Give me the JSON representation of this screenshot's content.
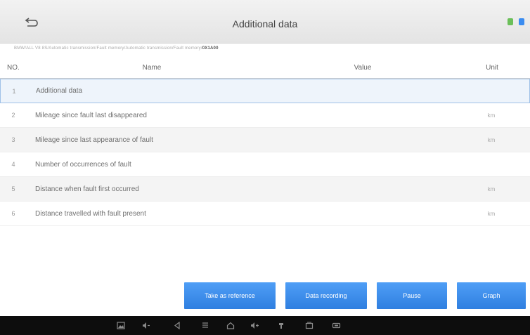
{
  "header": {
    "title": "Additional data",
    "path_text": "BMW/ALL V8 8S/Automatic transmission/Fault memory/Automatic transmission/Fault memory/",
    "path_code": "0X1A00"
  },
  "table": {
    "columns": {
      "no": "NO.",
      "name": "Name",
      "value": "Value",
      "unit": "Unit"
    },
    "rows": [
      {
        "no": "1",
        "name": "Additional data",
        "value": "",
        "unit": ""
      },
      {
        "no": "2",
        "name": "Mileage since fault last disappeared",
        "value": "",
        "unit": "km"
      },
      {
        "no": "3",
        "name": "Mileage since last appearance of fault",
        "value": "",
        "unit": "km"
      },
      {
        "no": "4",
        "name": "Number of occurrences of fault",
        "value": "",
        "unit": ""
      },
      {
        "no": "5",
        "name": "Distance when fault first occurred",
        "value": "",
        "unit": "km"
      },
      {
        "no": "6",
        "name": "Distance travelled with fault present",
        "value": "",
        "unit": "km"
      }
    ]
  },
  "buttons": {
    "reference": "Take as reference",
    "recording": "Data recording",
    "pause": "Pause",
    "graph": "Graph"
  },
  "colors": {
    "accent": "#3a8cf0",
    "navbar": "#0d0d0d"
  },
  "icons": {
    "back": "back-arrow-icon",
    "nav": [
      "screenshot-icon",
      "volume-down-icon",
      "back-icon",
      "menu-icon",
      "home-icon",
      "volume-up-icon",
      "vci-icon",
      "recent-apps-icon",
      "vehicle-icon"
    ]
  }
}
